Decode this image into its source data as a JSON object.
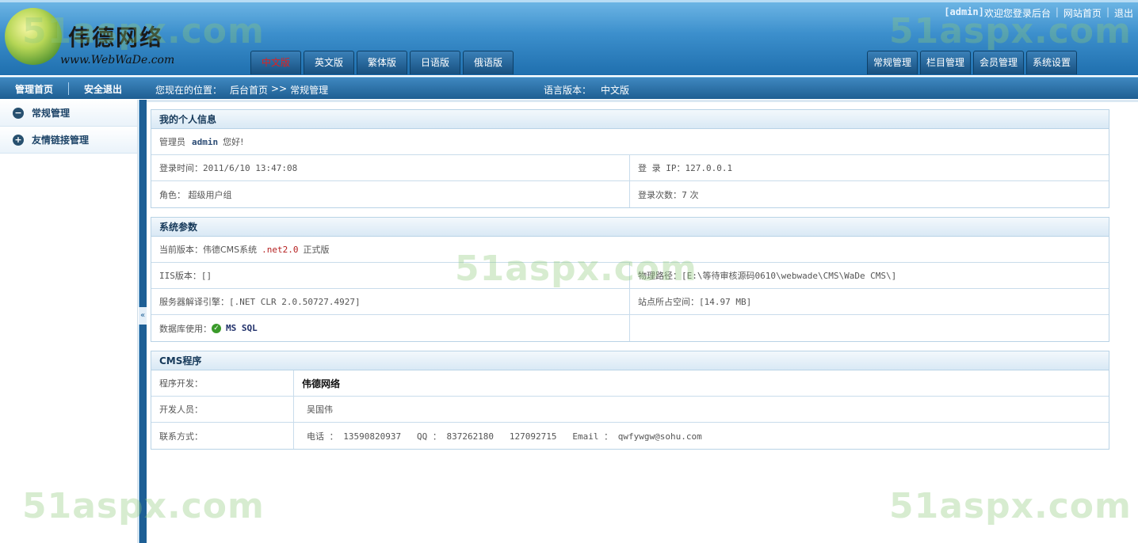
{
  "header": {
    "logo_title": "伟德网络",
    "logo_url": "www.WebWaDe.com",
    "top_links": {
      "admin_tag": "[admin]",
      "welcome": "欢迎您登录后台",
      "site_home": "网站首页",
      "logout": "退出"
    },
    "lang_tabs": [
      "中文版",
      "英文版",
      "繁体版",
      "日语版",
      "俄语版"
    ],
    "main_tabs": [
      "常规管理",
      "栏目管理",
      "会员管理",
      "系统设置"
    ]
  },
  "subbar": {
    "left_nav": [
      "管理首页",
      "安全退出"
    ],
    "location_label": "您现在的位置：",
    "crumbs": [
      "后台首页",
      ">>",
      "常规管理"
    ],
    "lang_label": "语言版本：",
    "lang_value": "中文版"
  },
  "sidebar": {
    "items": [
      {
        "label": "常规管理",
        "icon": "minus-circle-icon",
        "glyph": "−"
      },
      {
        "label": "友情链接管理",
        "icon": "plus-circle-icon",
        "glyph": "+"
      }
    ]
  },
  "divider": {
    "toggle": "«"
  },
  "profile": {
    "title": "我的个人信息",
    "greet_prefix": "管理员",
    "greet_user": "admin",
    "greet_suffix": "您好!",
    "login_time": "登录时间：2011/6/10 13:47:08",
    "login_ip": "登 录 IP：127.0.0.1",
    "role": "角色： 超级用户组",
    "login_count": "登录次数：7 次"
  },
  "system": {
    "title": "系统参数",
    "version_prefix": "当前版本：伟德CMS系统",
    "version_net": ".net2.0",
    "version_suffix": "正式版",
    "iis": "IIS版本：[]",
    "path": "物理路径：[E:\\等待审核源码0610\\webwade\\CMS\\WaDe CMS\\]",
    "engine": "服务器解译引擎：[.NET CLR 2.0.50727.4927]",
    "space": "站点所占空间：[14.97 MB]",
    "db_label": "数据库使用：",
    "db_value": "MS SQL"
  },
  "cms": {
    "title": "CMS程序",
    "rows": [
      {
        "label": "程序开发：",
        "value": "伟德网络"
      },
      {
        "label": "开发人员：",
        "value": "吴国伟"
      },
      {
        "label": "联系方式：",
        "value": "电话 ： 13590820937   QQ ： 837262180   127092715   Email ： qwfywgw@sohu.com"
      }
    ]
  },
  "watermarks": [
    "51aspx.com",
    "51aspx.com",
    "51aspx.com",
    "51aspx.com",
    "51aspx.com"
  ]
}
